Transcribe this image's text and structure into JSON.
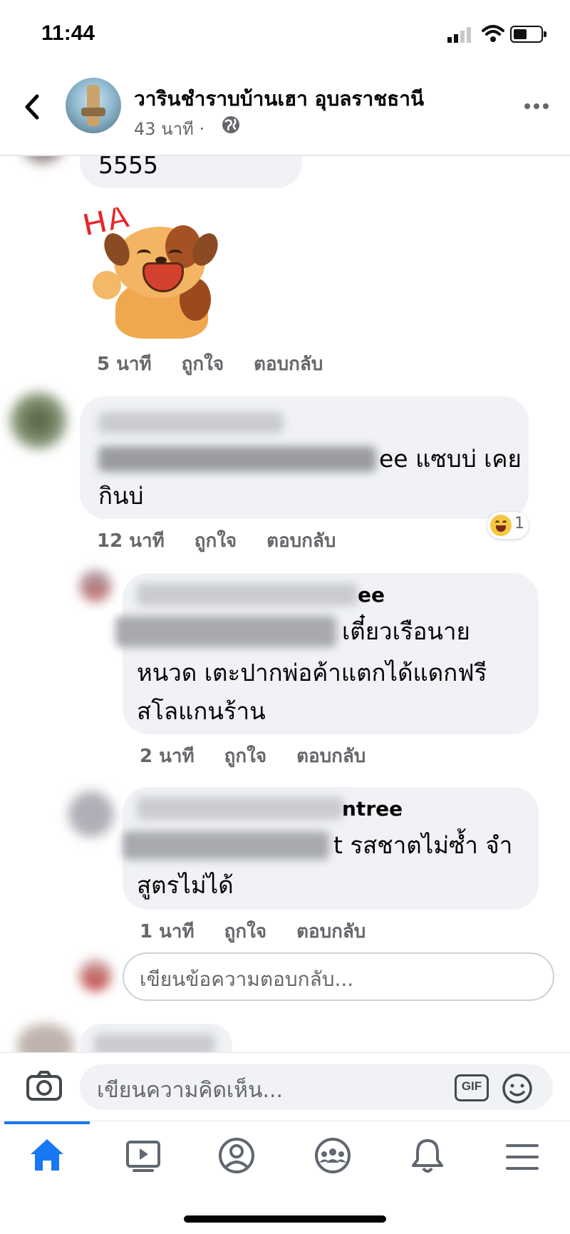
{
  "status": {
    "time": "11:44"
  },
  "header": {
    "title": "วารินชำราบบ้านเฮา อุบลราชธานี",
    "subtitle": "43 นาที ·"
  },
  "comments": [
    {
      "text": "5555",
      "sticker_text": "HA",
      "meta": {
        "time": "5 นาที",
        "like": "ถูกใจ",
        "reply": "ตอบกลับ"
      }
    },
    {
      "text_line1_visible": "ee แซบบ่ เคย",
      "text_line2": "กินบ่",
      "meta": {
        "time": "12 นาที",
        "like": "ถูกใจ",
        "reply": "ตอบกลับ"
      },
      "reaction_count": "1"
    },
    {
      "name_visible": "ee",
      "text_line1_visible": "เตี๋ยวเรือนาย",
      "text_line2": "หนวด เตะปากพ่อค้าแตกได้แดกฟรี",
      "text_line3": "สโลแกนร้าน",
      "meta": {
        "time": "2 นาที",
        "like": "ถูกใจ",
        "reply": "ตอบกลับ"
      }
    },
    {
      "name_visible": "ntree",
      "text_line1_visible": "t รสชาตไม่ซ้ำ  จำ",
      "text_line2": "สูตรไม่ได้",
      "meta": {
        "time": "1 นาที",
        "like": "ถูกใจ",
        "reply": "ตอบกลับ"
      }
    }
  ],
  "reply_input": {
    "placeholder": "เขียนข้อความตอบกลับ..."
  },
  "comment_input": {
    "placeholder": "เขียนความคิดเห็น...",
    "gif_label": "GIF"
  },
  "bottom_nav": [
    "home-icon",
    "watch-icon",
    "profile-icon",
    "groups-icon",
    "notifications-icon",
    "menu-icon"
  ],
  "colors": {
    "accent": "#1877f2",
    "bubble": "#f0f2f5",
    "secondary_text": "#65676b"
  }
}
